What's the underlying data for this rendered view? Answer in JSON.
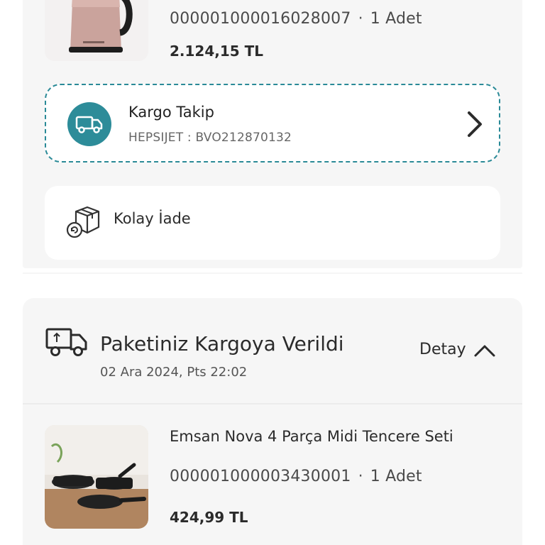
{
  "first_item": {
    "code": "000001000016028007",
    "qty": "1 Adet",
    "price": "2.124,15 TL",
    "image_icon": "kettle-image"
  },
  "tracking": {
    "title": "Kargo Takip",
    "subtitle": "HEPSIJET : BVO212870132",
    "icon": "truck-icon",
    "accent": "#2d8c99"
  },
  "returns": {
    "label": "Kolay İade",
    "icon": "return-box-icon"
  },
  "shipment": {
    "status": "Paketiniz Kargoya Verildi",
    "date": "02 Ara 2024, Pts 22:02",
    "detail_label": "Detay",
    "icon": "truck-icon"
  },
  "second_item": {
    "name": "Emsan Nova 4 Parça Midi Tencere Seti",
    "code": "000001000003430001",
    "qty": "1 Adet",
    "price": "424,99 TL",
    "image_icon": "cookware-image"
  }
}
